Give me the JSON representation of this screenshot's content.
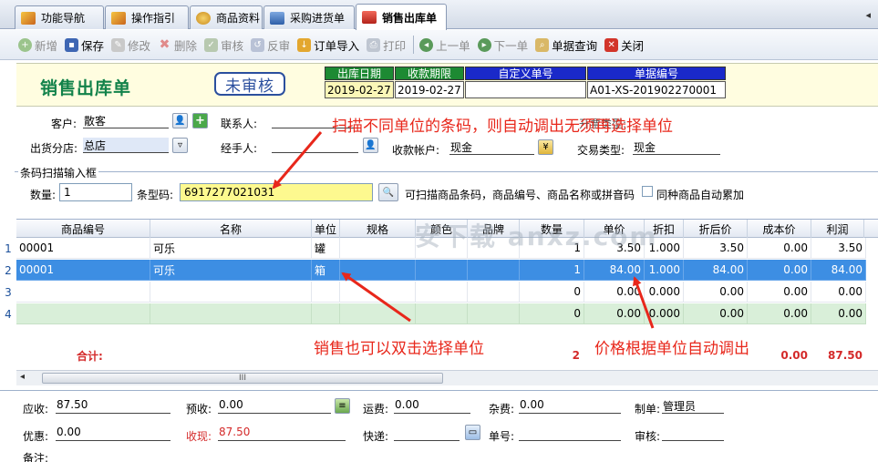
{
  "tabs": [
    {
      "label": "功能导航"
    },
    {
      "label": "操作指引"
    },
    {
      "label": "商品资料"
    },
    {
      "label": "采购进货单"
    },
    {
      "label": "销售出库单"
    }
  ],
  "tab_scroll": "◂",
  "toolbar": {
    "new": "新增",
    "save": "保存",
    "edit": "修改",
    "delete": "删除",
    "audit": "审核",
    "unaudit": "反审",
    "import_order": "订单导入",
    "print": "打印",
    "prev": "上一单",
    "next": "下一单",
    "query": "单据查询",
    "close": "关闭"
  },
  "header": {
    "title": "销售出库单",
    "status": "未审核",
    "fields": [
      {
        "label": "出库日期",
        "value": "2019-02-27",
        "color": "#1d8a33"
      },
      {
        "label": "收款期限",
        "value": "2019-02-27",
        "color": "#1d8a33"
      },
      {
        "label": "自定义单号",
        "value": "",
        "color": "#1a29c9"
      },
      {
        "label": "单据编号",
        "value": "A01-XS-201902270001",
        "color": "#1a29c9"
      }
    ]
  },
  "form": {
    "customer_label": "客户:",
    "customer": "散客",
    "contact_label": "联系人:",
    "branch_label": "出货分店:",
    "branch": "总店",
    "handler_label": "经手人:",
    "account_label": "收款帐户:",
    "account": "现金",
    "trade_label": "交易类型:",
    "trade": "现金",
    "hidden_label": "开票类型:"
  },
  "barcode": {
    "group_title": "条码扫描输入框",
    "qty_label": "数量:",
    "qty": "1",
    "code_label": "条型码:",
    "code": "6917277021031",
    "hint": "可扫描商品条码，商品编号、商品名称或拼音码",
    "accumulate_label": "同种商品自动累加"
  },
  "grid": {
    "columns": [
      "商品编号",
      "名称",
      "单位",
      "规格",
      "颜色",
      "品牌",
      "数量",
      "单价",
      "折扣",
      "折后价",
      "成本价",
      "利润"
    ],
    "rows": [
      {
        "no": "1",
        "code": "00001",
        "name": "可乐",
        "unit": "罐",
        "spec": "",
        "color": "",
        "brand": "",
        "qty": "1",
        "price": "3.50",
        "discount": "1.000",
        "net": "3.50",
        "cost": "0.00",
        "profit": "3.50"
      },
      {
        "no": "2",
        "code": "00001",
        "name": "可乐",
        "unit": "箱",
        "spec": "",
        "color": "",
        "brand": "",
        "qty": "1",
        "price": "84.00",
        "discount": "1.000",
        "net": "84.00",
        "cost": "0.00",
        "profit": "84.00"
      },
      {
        "no": "3",
        "code": "",
        "name": "",
        "unit": "",
        "spec": "",
        "color": "",
        "brand": "",
        "qty": "0",
        "price": "0.00",
        "discount": "0.000",
        "net": "0.00",
        "cost": "0.00",
        "profit": "0.00"
      },
      {
        "no": "4",
        "code": "",
        "name": "",
        "unit": "",
        "spec": "",
        "color": "",
        "brand": "",
        "qty": "0",
        "price": "0.00",
        "discount": "0.000",
        "net": "0.00",
        "cost": "0.00",
        "profit": "0.00"
      }
    ],
    "sum_label": "合计:",
    "sum_qty": "2",
    "sum_cost": "0.00",
    "sum_profit": "87.50",
    "scroll_grip": "III"
  },
  "footer": {
    "receivable_label": "应收:",
    "receivable": "87.50",
    "prepaid_label": "预收:",
    "prepaid": "0.00",
    "freight_label": "运费:",
    "freight": "0.00",
    "misc_label": "杂费:",
    "misc": "0.00",
    "maker_label": "制单:",
    "maker": "管理员",
    "discount_label": "优惠:",
    "discount": "0.00",
    "cash_label": "收现:",
    "cash": "87.50",
    "courier_label": "快递:",
    "waybill_label": "单号:",
    "auditor_label": "审核:",
    "remark_label": "备注:"
  },
  "annotations": {
    "top": "扫描不同单位的条码，则自动调出无须再选择单位",
    "left": "销售也可以双击选择单位",
    "right": "价格根据单位自动调出"
  },
  "watermark": "安下载 anxz.com"
}
